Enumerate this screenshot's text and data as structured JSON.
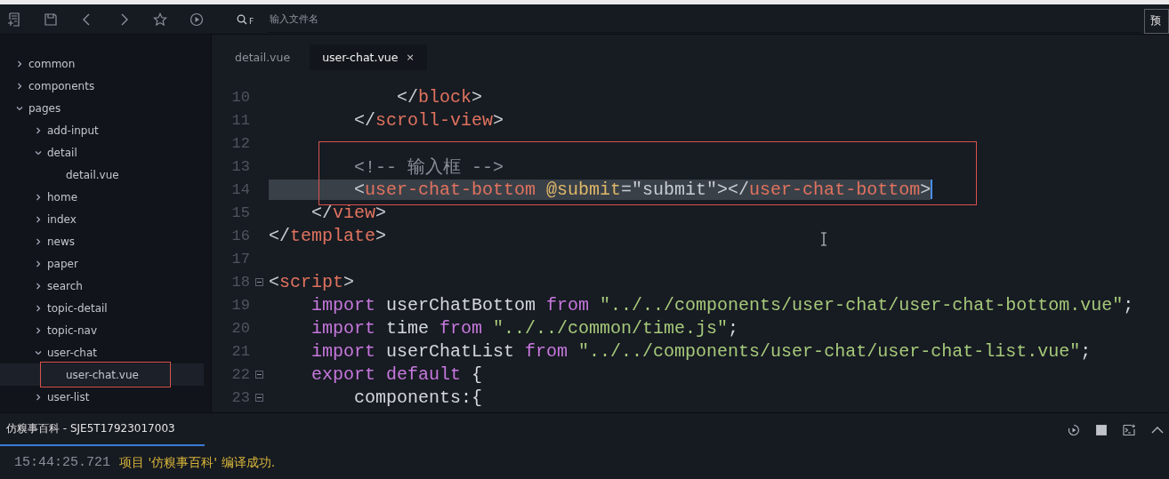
{
  "toolbar": {
    "search": {
      "key_hint": "F",
      "placeholder": "输入文件名"
    },
    "preview_button": "预"
  },
  "sidebar": {
    "items": [
      {
        "label": "common",
        "kind": "folder",
        "expanded": false,
        "selected": false
      },
      {
        "label": "components",
        "kind": "folder",
        "expanded": false,
        "selected": false
      },
      {
        "label": "pages",
        "kind": "folder",
        "expanded": true,
        "selected": false,
        "children": [
          {
            "label": "add-input",
            "kind": "folder",
            "expanded": false,
            "selected": false
          },
          {
            "label": "detail",
            "kind": "folder",
            "expanded": true,
            "selected": false,
            "children": [
              {
                "label": "detail.vue",
                "kind": "file",
                "selected": false
              }
            ]
          },
          {
            "label": "home",
            "kind": "folder",
            "expanded": false,
            "selected": false
          },
          {
            "label": "index",
            "kind": "folder",
            "expanded": false,
            "selected": false
          },
          {
            "label": "news",
            "kind": "folder",
            "expanded": false,
            "selected": false
          },
          {
            "label": "paper",
            "kind": "folder",
            "expanded": false,
            "selected": false
          },
          {
            "label": "search",
            "kind": "folder",
            "expanded": false,
            "selected": false
          },
          {
            "label": "topic-detail",
            "kind": "folder",
            "expanded": false,
            "selected": false
          },
          {
            "label": "topic-nav",
            "kind": "folder",
            "expanded": false,
            "selected": false
          },
          {
            "label": "user-chat",
            "kind": "folder",
            "expanded": true,
            "selected": false,
            "children": [
              {
                "label": "user-chat.vue",
                "kind": "file",
                "selected": true
              }
            ]
          },
          {
            "label": "user-list",
            "kind": "folder",
            "expanded": false,
            "selected": false
          }
        ]
      }
    ]
  },
  "tabs": [
    {
      "label": "detail.vue",
      "selected": false
    },
    {
      "label": "user-chat.vue",
      "selected": true,
      "close": "×"
    }
  ],
  "editor": {
    "lines": [
      {
        "number": "10",
        "fold": false,
        "selected": false,
        "tokens": [
          {
            "kind": "punct",
            "text": "            </"
          },
          {
            "kind": "tag",
            "text": "block"
          },
          {
            "kind": "punct",
            "text": ">"
          }
        ]
      },
      {
        "number": "11",
        "fold": false,
        "selected": false,
        "tokens": [
          {
            "kind": "punct",
            "text": "        </"
          },
          {
            "kind": "tag",
            "text": "scroll-view"
          },
          {
            "kind": "punct",
            "text": ">"
          }
        ]
      },
      {
        "number": "12",
        "fold": false,
        "selected": false
      },
      {
        "number": "13",
        "fold": false,
        "selected": false,
        "tokens": [
          {
            "kind": "comment",
            "text": "        <!-- 输入框 -->"
          }
        ]
      },
      {
        "number": "14",
        "fold": false,
        "selected": true,
        "tokens": [
          {
            "kind": "punct",
            "text": "        <"
          },
          {
            "kind": "tag",
            "text": "user-chat-bottom"
          },
          {
            "kind": "attr",
            "text": " @submit"
          },
          {
            "kind": "punct",
            "text": "=\"submit\"></"
          },
          {
            "kind": "tag",
            "text": "user-chat-bottom"
          },
          {
            "kind": "punct",
            "text": ">"
          }
        ]
      },
      {
        "number": "15",
        "fold": false,
        "selected": false,
        "tokens": [
          {
            "kind": "punct",
            "text": "    </"
          },
          {
            "kind": "tag",
            "text": "view"
          },
          {
            "kind": "punct",
            "text": ">"
          }
        ]
      },
      {
        "number": "16",
        "fold": false,
        "selected": false,
        "tokens": [
          {
            "kind": "punct",
            "text": "</"
          },
          {
            "kind": "tag",
            "text": "template"
          },
          {
            "kind": "punct",
            "text": ">"
          }
        ]
      },
      {
        "number": "17",
        "fold": false,
        "selected": false
      },
      {
        "number": "18",
        "fold": true,
        "selected": false,
        "tokens": [
          {
            "kind": "punct",
            "text": "<"
          },
          {
            "kind": "tag",
            "text": "script"
          },
          {
            "kind": "punct",
            "text": ">"
          }
        ]
      },
      {
        "number": "19",
        "fold": false,
        "selected": false,
        "tokens": [
          {
            "kind": "keyword",
            "text": "    import"
          },
          {
            "kind": "plain",
            "text": " userChatBottom "
          },
          {
            "kind": "keyword",
            "text": "from"
          },
          {
            "kind": "string",
            "text": " \"../../components/user-chat/user-chat-bottom.vue\""
          },
          {
            "kind": "plain",
            "text": ";"
          }
        ]
      },
      {
        "number": "20",
        "fold": false,
        "selected": false,
        "tokens": [
          {
            "kind": "keyword",
            "text": "    import"
          },
          {
            "kind": "plain",
            "text": " time "
          },
          {
            "kind": "keyword",
            "text": "from"
          },
          {
            "kind": "string",
            "text": " \"../../common/time.js\""
          },
          {
            "kind": "plain",
            "text": ";"
          }
        ]
      },
      {
        "number": "21",
        "fold": false,
        "selected": false,
        "tokens": [
          {
            "kind": "keyword",
            "text": "    import"
          },
          {
            "kind": "plain",
            "text": " userChatList "
          },
          {
            "kind": "keyword",
            "text": "from"
          },
          {
            "kind": "string",
            "text": " \"../../components/user-chat/user-chat-list.vue\""
          },
          {
            "kind": "plain",
            "text": ";"
          }
        ]
      },
      {
        "number": "22",
        "fold": true,
        "selected": false,
        "tokens": [
          {
            "kind": "keyword",
            "text": "    export default"
          },
          {
            "kind": "plain",
            "text": " {"
          }
        ]
      },
      {
        "number": "23",
        "fold": true,
        "selected": false,
        "tokens": [
          {
            "kind": "plain",
            "text": "        components:{"
          }
        ]
      }
    ]
  },
  "console": {
    "tabs": [
      {
        "label": "仿糗事百科 - SJE5T17923017003",
        "selected": true
      }
    ],
    "lines": [
      {
        "time": "15:44:25.721",
        "message": "项目 '仿糗事百科' 编译成功."
      }
    ]
  }
}
